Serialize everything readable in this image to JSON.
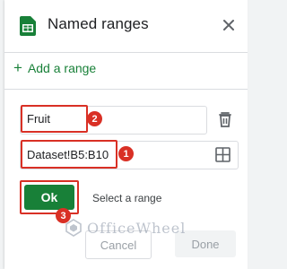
{
  "panel": {
    "title": "Named ranges",
    "icons": {
      "app": "google-sheets-icon",
      "close": "close-icon"
    }
  },
  "add_range": {
    "label": "Add a range",
    "icon": "plus-icon"
  },
  "range_entry": {
    "name_value": "Fruit",
    "range_value": "Dataset!B5:B10",
    "delete_icon": "trash-icon",
    "select_range_icon": "grid-icon"
  },
  "buttons": {
    "ok": "Ok",
    "select_range": "Select a range",
    "cancel": "Cancel",
    "done": "Done"
  },
  "annotations": {
    "badge_1": "1",
    "badge_2": "2",
    "badge_3": "3"
  },
  "watermark": {
    "text": "OfficeWheel"
  },
  "colors": {
    "accent_green": "#188038",
    "highlight_red": "#d93025",
    "border": "#dadce0"
  }
}
